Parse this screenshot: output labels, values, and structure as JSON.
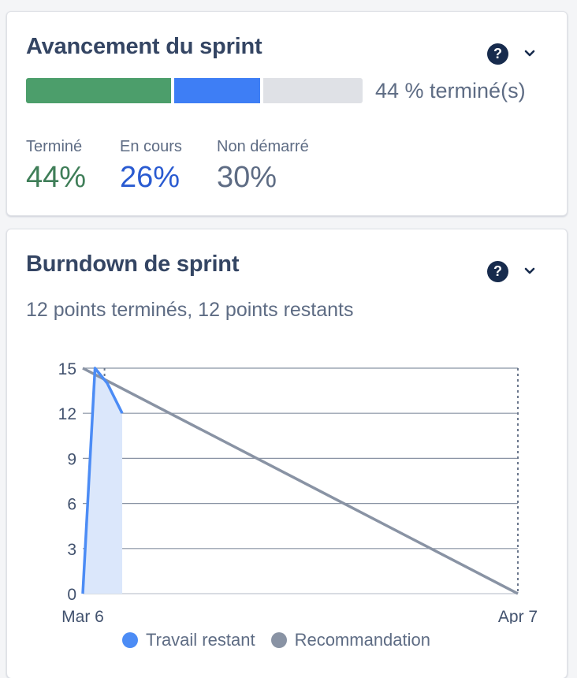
{
  "progress_card": {
    "title": "Avancement du sprint",
    "help_icon_text": "?",
    "percent_label": "44 % terminé(s)",
    "bar": {
      "done": 44,
      "in_progress": 26,
      "not_started": 30
    },
    "stats": [
      {
        "label": "Terminé",
        "value": "44%"
      },
      {
        "label": "En cours",
        "value": "26%"
      },
      {
        "label": "Non démarré",
        "value": "30%"
      }
    ]
  },
  "burndown_card": {
    "title": "Burndown de sprint",
    "help_icon_text": "?",
    "summary": "12 points terminés, 12 points restants",
    "legend": [
      {
        "label": "Travail restant",
        "color": "#4c8cf5"
      },
      {
        "label": "Recommandation",
        "color": "#8993a4"
      }
    ]
  },
  "colors": {
    "done": "#4c9e6b",
    "in_progress": "#3e7ef5",
    "not_started": "#dfe1e6",
    "remaining_line": "#4c8cf5",
    "guideline": "#8993a4"
  },
  "icons": {
    "help": "question-circle-icon",
    "expand": "chevron-down-icon"
  },
  "chart_data": {
    "type": "line",
    "title": "",
    "xlabel": "",
    "ylabel": "",
    "x_tick_labels": [
      "Mar 6",
      "Apr 7"
    ],
    "x_range_days": [
      0,
      32
    ],
    "ylim": [
      0,
      15
    ],
    "y_ticks": [
      0,
      3,
      6,
      9,
      12,
      15
    ],
    "grid": true,
    "today_day": 1.6,
    "series": [
      {
        "name": "Travail restant",
        "color": "#4c8cf5",
        "fill": true,
        "points": [
          [
            0,
            0
          ],
          [
            0.9,
            15
          ],
          [
            1.8,
            14
          ],
          [
            2.9,
            12
          ]
        ]
      },
      {
        "name": "Recommandation",
        "color": "#8993a4",
        "fill": false,
        "points": [
          [
            0,
            15
          ],
          [
            32,
            0
          ]
        ]
      }
    ]
  }
}
